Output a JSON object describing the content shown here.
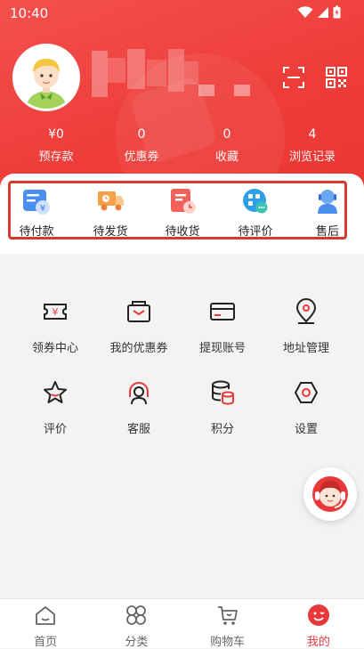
{
  "status_bar": {
    "time": "10:40"
  },
  "header": {
    "stats": [
      {
        "value": "¥0",
        "label": "预存款"
      },
      {
        "value": "0",
        "label": "优惠券"
      },
      {
        "value": "0",
        "label": "收藏"
      },
      {
        "value": "4",
        "label": "浏览记录"
      }
    ]
  },
  "orders": {
    "items": [
      {
        "label": "待付款",
        "icon": "wallet-icon"
      },
      {
        "label": "待发货",
        "icon": "delivery-truck-icon"
      },
      {
        "label": "待收货",
        "icon": "package-clock-icon"
      },
      {
        "label": "待评价",
        "icon": "chat-bubble-icon"
      },
      {
        "label": "售后",
        "icon": "service-agent-icon"
      }
    ]
  },
  "services": {
    "items": [
      {
        "label": "领券中心",
        "icon": "coupon-icon"
      },
      {
        "label": "我的优惠券",
        "icon": "coupon-bag-icon"
      },
      {
        "label": "提现账号",
        "icon": "card-icon"
      },
      {
        "label": "地址管理",
        "icon": "location-pin-icon"
      },
      {
        "label": "评价",
        "icon": "star-icon"
      },
      {
        "label": "客服",
        "icon": "headset-icon"
      },
      {
        "label": "积分",
        "icon": "coins-icon"
      },
      {
        "label": "设置",
        "icon": "settings-hexagon-icon"
      }
    ]
  },
  "tabbar": {
    "tabs": [
      {
        "label": "首页",
        "icon": "home-icon"
      },
      {
        "label": "分类",
        "icon": "category-icon"
      },
      {
        "label": "购物车",
        "icon": "cart-icon"
      },
      {
        "label": "我的",
        "icon": "smile-face-icon",
        "active": true
      }
    ]
  },
  "colors": {
    "brand": "#ee3c38",
    "active_tab": "#e8393a",
    "order_box": "#d63a2e"
  }
}
